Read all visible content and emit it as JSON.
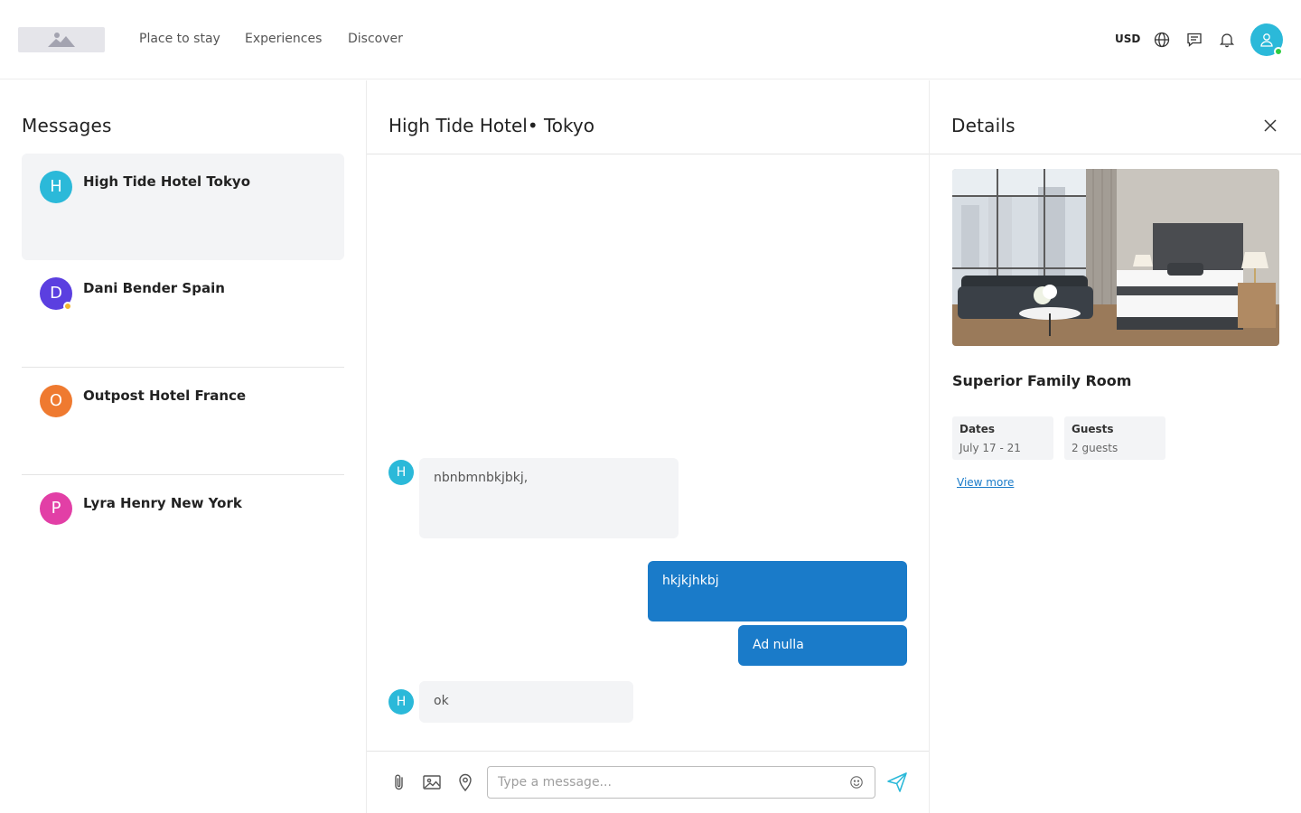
{
  "header": {
    "nav": [
      "Place to stay",
      "Experiences",
      "Discover"
    ],
    "currency": "USD",
    "icons": [
      "globe-icon",
      "chat-icon",
      "bell-icon",
      "user-icon"
    ]
  },
  "conversations_panel": {
    "title": "Messages",
    "items": [
      {
        "initial": "H",
        "name": "High Tide Hotel Tokyo",
        "color": "#2bb9d9",
        "active": true
      },
      {
        "initial": "D",
        "name": "Dani Bender Spain",
        "color": "#5b3fe0",
        "status": "away"
      },
      {
        "initial": "O",
        "name": "Outpost Hotel France",
        "color": "#ef7a30"
      },
      {
        "initial": "P",
        "name": "Lyra Henry New York",
        "color": "#e23fa6"
      }
    ]
  },
  "chat": {
    "title": "High Tide Hotel• Tokyo",
    "messages": [
      {
        "from": "other",
        "initial": "H",
        "text": "nbnbmnbkjbkj,"
      },
      {
        "from": "me",
        "text": "hkjkjhkbj"
      },
      {
        "from": "me",
        "text": "Ad  nulla"
      },
      {
        "from": "other",
        "initial": "H",
        "text": "ok"
      }
    ],
    "composer": {
      "placeholder": "Type a message...",
      "icons": [
        "paperclip-icon",
        "image-icon",
        "location-pin-icon",
        "emoji-icon",
        "send-icon"
      ]
    }
  },
  "details": {
    "title": "Details",
    "room_name": "Superior Family Room",
    "dates_label": "Dates",
    "dates_value": "July 17 - 21",
    "guests_label": "Guests",
    "guests_value": "2 guests",
    "view_more": "View more"
  },
  "colors": {
    "accent": "#1a7bc9",
    "avatar_teal": "#2bb9d9",
    "bubble_gray": "#f3f4f6",
    "online": "#2ecc40",
    "away": "#f2b630"
  }
}
